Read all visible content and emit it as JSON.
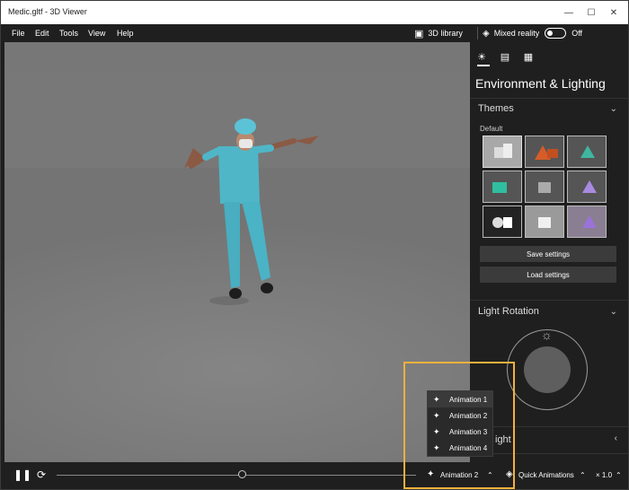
{
  "window": {
    "title": "Medic.gltf - 3D Viewer"
  },
  "menubar": {
    "items": [
      "File",
      "Edit",
      "Tools",
      "View",
      "Help"
    ],
    "library_label": "3D library",
    "mixed_reality_label": "Mixed reality",
    "mixed_reality_state": "Off"
  },
  "panel": {
    "title": "Environment & Lighting",
    "themes_title": "Themes",
    "themes_sub": "Default",
    "save_label": "Save settings",
    "load_label": "Load settings",
    "light_rotation_title": "Light Rotation",
    "partial_label": "ight"
  },
  "bottombar": {
    "current_animation": "Animation 2",
    "quick_animations_label": "Quick Animations",
    "speed_label": "× 1.0",
    "progress": 0.5
  },
  "animation_menu": {
    "items": [
      "Animation 1",
      "Animation 2",
      "Animation 3",
      "Animation 4"
    ],
    "selected_index": 0
  },
  "colors": {
    "highlight": "#f3b13b",
    "scrubs": "#4fb6c8"
  }
}
